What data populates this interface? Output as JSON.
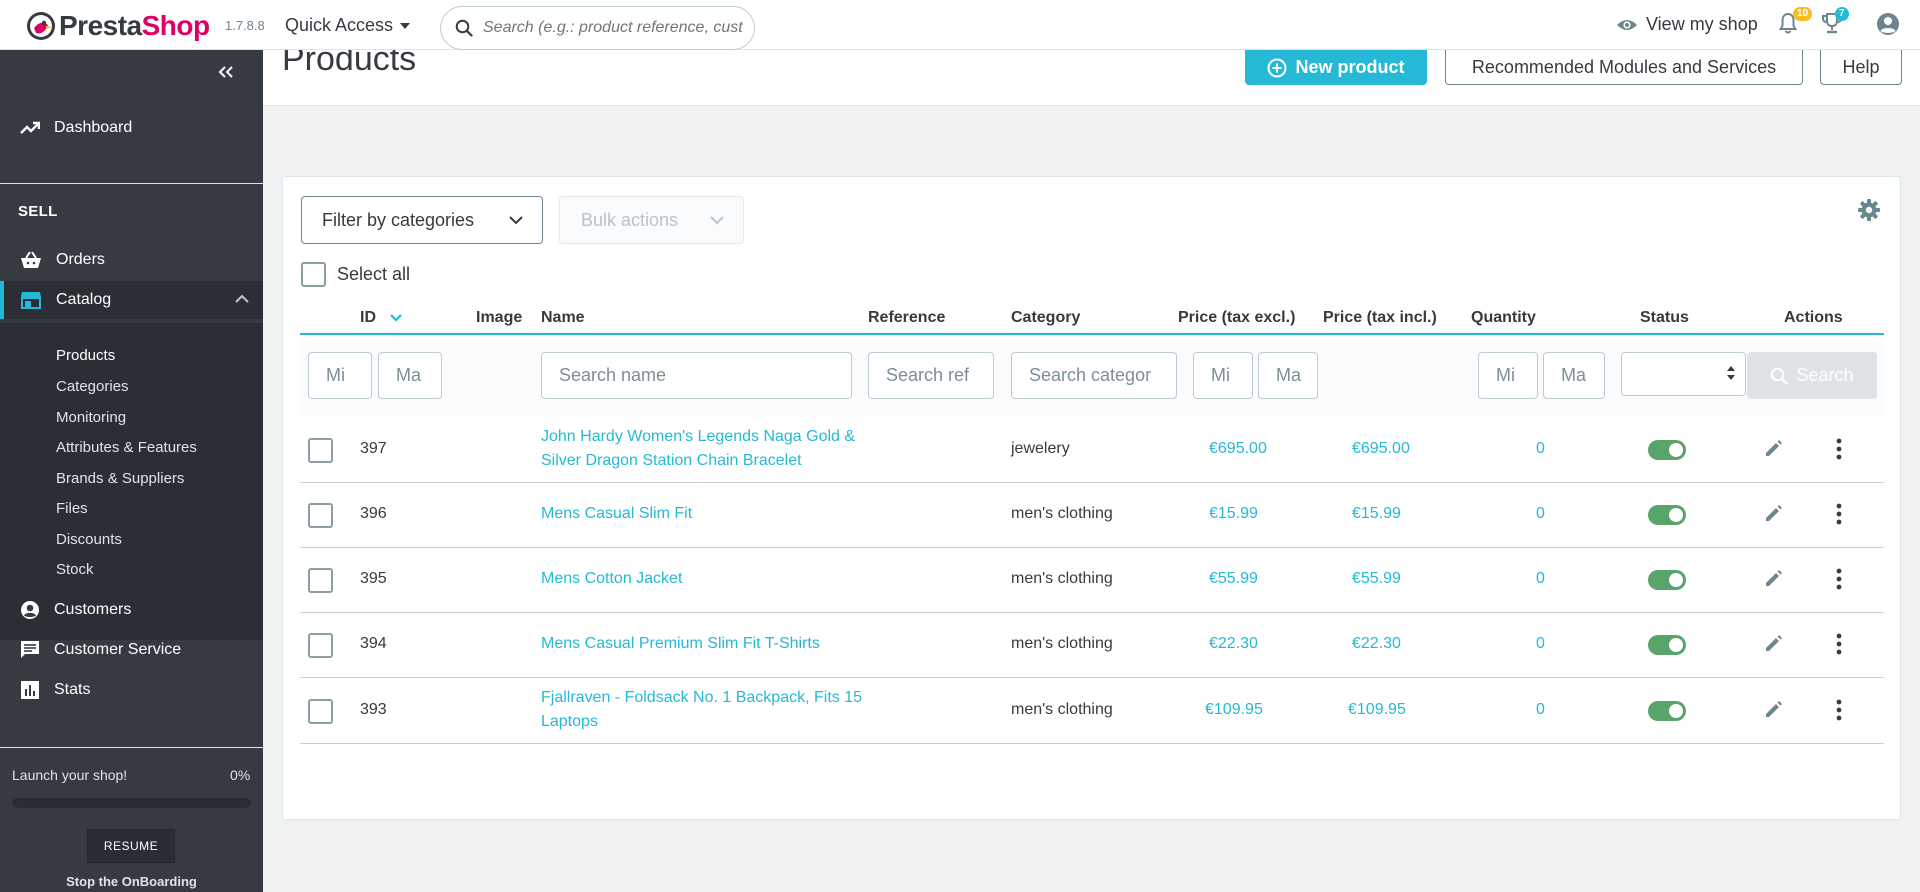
{
  "header": {
    "logo_part1": "Presta",
    "logo_part2": "Shop",
    "version": "1.7.8.8",
    "quick_access": "Quick Access",
    "search_placeholder": "Search (e.g.: product reference, custon",
    "view_shop": "View my shop",
    "notifications_count": "10",
    "achievements_count": "7"
  },
  "sidebar": {
    "dashboard": "Dashboard",
    "section_sell": "SELL",
    "orders": "Orders",
    "catalog": "Catalog",
    "catalog_sub": [
      "Products",
      "Categories",
      "Monitoring",
      "Attributes & Features",
      "Brands & Suppliers",
      "Files",
      "Discounts",
      "Stock"
    ],
    "customers": "Customers",
    "customer_service": "Customer Service",
    "stats": "Stats",
    "onboarding": {
      "label": "Launch your shop!",
      "percent_label": "0%",
      "progress": 0,
      "resume": "RESUME",
      "stop": "Stop the OnBoarding"
    }
  },
  "page": {
    "title": "Products",
    "new_product": "New product",
    "recommended": "Recommended Modules and Services",
    "help": "Help"
  },
  "toolbar": {
    "filter_categories": "Filter by categories",
    "bulk_actions": "Bulk actions",
    "select_all": "Select all"
  },
  "table": {
    "headers": {
      "id": "ID",
      "image": "Image",
      "name": "Name",
      "reference": "Reference",
      "category": "Category",
      "price_excl": "Price (tax excl.)",
      "price_incl": "Price (tax incl.)",
      "quantity": "Quantity",
      "status": "Status",
      "actions": "Actions"
    },
    "filters": {
      "id_min": "Mi",
      "id_max": "Ma",
      "name": "Search name",
      "reference": "Search ref",
      "category": "Search categor",
      "price_min": "Mi",
      "price_max": "Ma",
      "qty_min": "Mi",
      "qty_max": "Ma",
      "search_button": "Search"
    },
    "rows": [
      {
        "id": "397",
        "name": "John Hardy Women's Legends Naga Gold & Silver Dragon Station Chain Bracelet",
        "category": "jewelery",
        "price_excl": "€695.00",
        "price_incl": "€695.00",
        "quantity": "0",
        "active": true
      },
      {
        "id": "396",
        "name": "Mens Casual Slim Fit",
        "category": "men's clothing",
        "price_excl": "€15.99",
        "price_incl": "€15.99",
        "quantity": "0",
        "active": true
      },
      {
        "id": "395",
        "name": "Mens Cotton Jacket",
        "category": "men's clothing",
        "price_excl": "€55.99",
        "price_incl": "€55.99",
        "quantity": "0",
        "active": true
      },
      {
        "id": "394",
        "name": "Mens Casual Premium Slim Fit T-Shirts",
        "category": "men's clothing",
        "price_excl": "€22.30",
        "price_incl": "€22.30",
        "quantity": "0",
        "active": true
      },
      {
        "id": "393",
        "name": "Fjallraven - Foldsack No. 1 Backpack, Fits 15 Laptops",
        "category": "men's clothing",
        "price_excl": "€109.95",
        "price_incl": "€109.95",
        "quantity": "0",
        "active": true
      }
    ]
  },
  "colors": {
    "accent": "#25b9d7",
    "brand_pink": "#df0067",
    "sidebar_bg": "#363a41",
    "toggle_on": "#59a46a"
  }
}
